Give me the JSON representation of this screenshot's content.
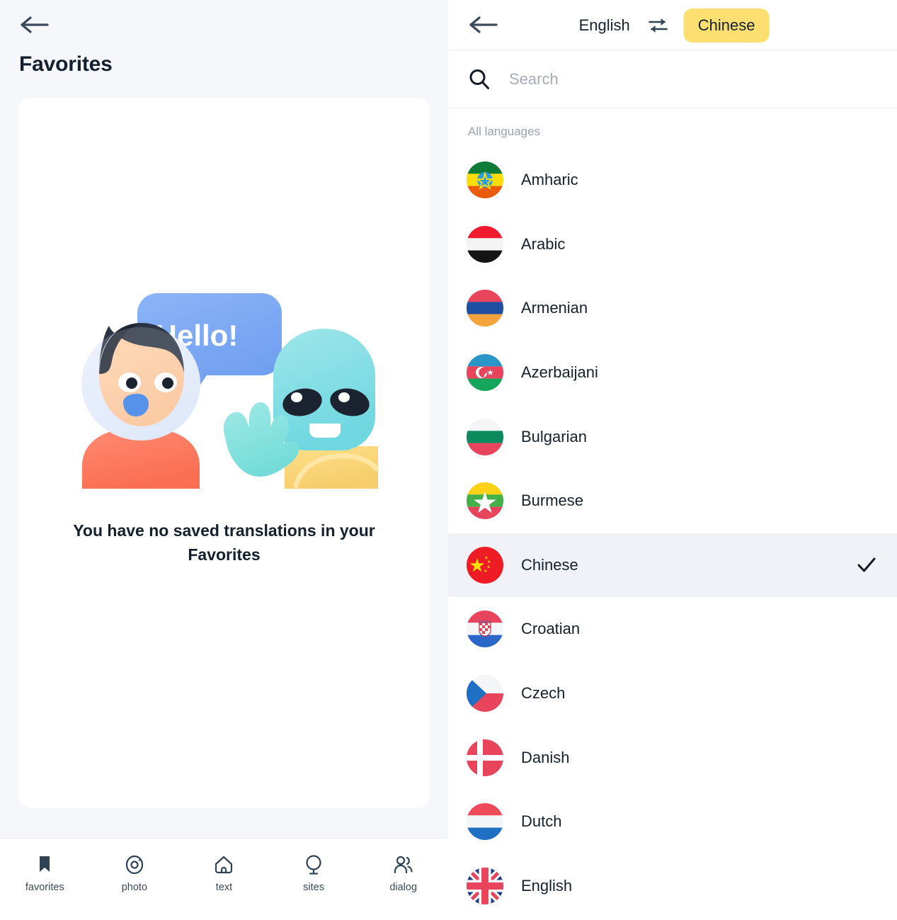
{
  "left": {
    "back_icon": "arrow-left-icon",
    "title": "Favorites",
    "illustration": {
      "name": "astronaut-alien-illustration",
      "speech_bubble_text": "Hello!"
    },
    "empty_state_text": "You have no saved translations in your Favorites",
    "tabs": [
      {
        "label": "favorites",
        "icon": "bookmark-icon",
        "active": true
      },
      {
        "label": "photo",
        "icon": "camera-icon",
        "active": false
      },
      {
        "label": "text",
        "icon": "text-house-icon",
        "active": false
      },
      {
        "label": "sites",
        "icon": "sites-balloon-icon",
        "active": false
      },
      {
        "label": "dialog",
        "icon": "people-icon",
        "active": false
      }
    ]
  },
  "right": {
    "back_icon": "arrow-left-icon",
    "source_language": "English",
    "swap_icon": "swap-arrows-icon",
    "target_language": "Chinese",
    "search": {
      "icon": "search-icon",
      "value": "",
      "placeholder": "Search"
    },
    "section_label": "All languages",
    "selected_language": "Chinese",
    "check_icon": "check-icon",
    "languages": [
      {
        "name": "Amharic",
        "flag": "et",
        "selected": false
      },
      {
        "name": "Arabic",
        "flag": "ye",
        "selected": false
      },
      {
        "name": "Armenian",
        "flag": "am",
        "selected": false
      },
      {
        "name": "Azerbaijani",
        "flag": "az",
        "selected": false
      },
      {
        "name": "Bulgarian",
        "flag": "bg",
        "selected": false
      },
      {
        "name": "Burmese",
        "flag": "mm",
        "selected": false
      },
      {
        "name": "Chinese",
        "flag": "cn",
        "selected": true
      },
      {
        "name": "Croatian",
        "flag": "hr",
        "selected": false
      },
      {
        "name": "Czech",
        "flag": "cz",
        "selected": false
      },
      {
        "name": "Danish",
        "flag": "dk",
        "selected": false
      },
      {
        "name": "Dutch",
        "flag": "nl",
        "selected": false
      },
      {
        "name": "English",
        "flag": "gb",
        "selected": false
      }
    ]
  },
  "colors": {
    "accent_yellow": "#fcdf70",
    "page_bg": "#f6f7fb",
    "card_bg": "#ffffff",
    "text_dark": "#15202e",
    "text_muted": "#9aa1ad",
    "selected_row": "#f1f2f7"
  }
}
